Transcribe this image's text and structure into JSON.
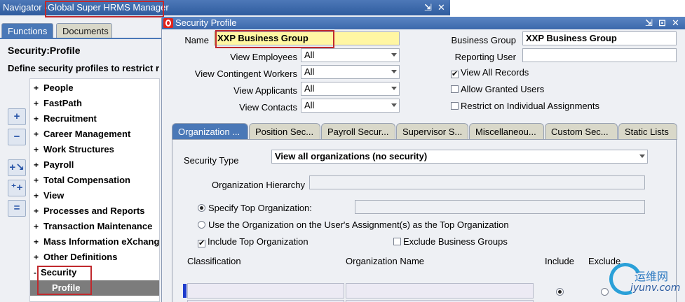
{
  "navigator": {
    "title_prefix": "Navigator - ",
    "title_responsibility": "Global Super HRMS Manager",
    "tabs": [
      "Functions",
      "Documents"
    ],
    "heading": "Security:Profile",
    "description": "Define security profiles to restrict r",
    "side_buttons": [
      "expand-icon",
      "collapse-icon",
      "expand-branch-icon",
      "expand-all-icon",
      "collapse-all-icon"
    ],
    "tree_items": [
      {
        "exp": "+",
        "label": "People"
      },
      {
        "exp": "+",
        "label": "FastPath"
      },
      {
        "exp": "+",
        "label": "Recruitment"
      },
      {
        "exp": "+",
        "label": "Career Management"
      },
      {
        "exp": "+",
        "label": "Work Structures"
      },
      {
        "exp": "+",
        "label": "Payroll"
      },
      {
        "exp": "+",
        "label": "Total Compensation"
      },
      {
        "exp": "+",
        "label": "View"
      },
      {
        "exp": "+",
        "label": "Processes and Reports"
      },
      {
        "exp": "+",
        "label": "Transaction Maintenance"
      },
      {
        "exp": "+",
        "label": "Mass Information eXchange"
      },
      {
        "exp": "+",
        "label": "Other Definitions"
      },
      {
        "exp": "-",
        "label": "Security"
      },
      {
        "exp": "",
        "label": "Profile"
      }
    ]
  },
  "security_profile": {
    "title": "Security Profile",
    "name_label": "Name",
    "name_value": "XXP Business Group",
    "business_group_label": "Business Group",
    "business_group_value": "XXP Business Group",
    "reporting_user_label": "Reporting User",
    "reporting_user_value": "",
    "view_employees_label": "View Employees",
    "view_employees_value": "All",
    "view_cwk_label": "View Contingent Workers",
    "view_cwk_value": "All",
    "view_applicants_label": "View Applicants",
    "view_applicants_value": "All",
    "view_contacts_label": "View Contacts",
    "view_contacts_value": "All",
    "view_all_records_label": "View All Records",
    "allow_granted_users_label": "Allow Granted Users",
    "restrict_individual_label": "Restrict on Individual Assignments",
    "tabs": [
      "Organization ...",
      "Position Sec...",
      "Payroll Secur...",
      "Supervisor S...",
      "Miscellaneou...",
      "Custom Sec...",
      "Static Lists"
    ],
    "org_tab": {
      "security_type_label": "Security Type",
      "security_type_value": "View all organizations (no security)",
      "org_hierarchy_label": "Organization Hierarchy",
      "specify_top_org_label": "Specify Top Organization:",
      "use_user_assignment_label": "Use the Organization on the User's Assignment(s) as the Top Organization",
      "include_top_org_label": "Include Top Organization",
      "exclude_bg_label": "Exclude Business Groups",
      "col_classification": "Classification",
      "col_org_name": "Organization Name",
      "col_include": "Include",
      "col_exclude": "Exclude"
    }
  },
  "watermark": {
    "cn": "运维网",
    "en": "iyunv.com"
  }
}
